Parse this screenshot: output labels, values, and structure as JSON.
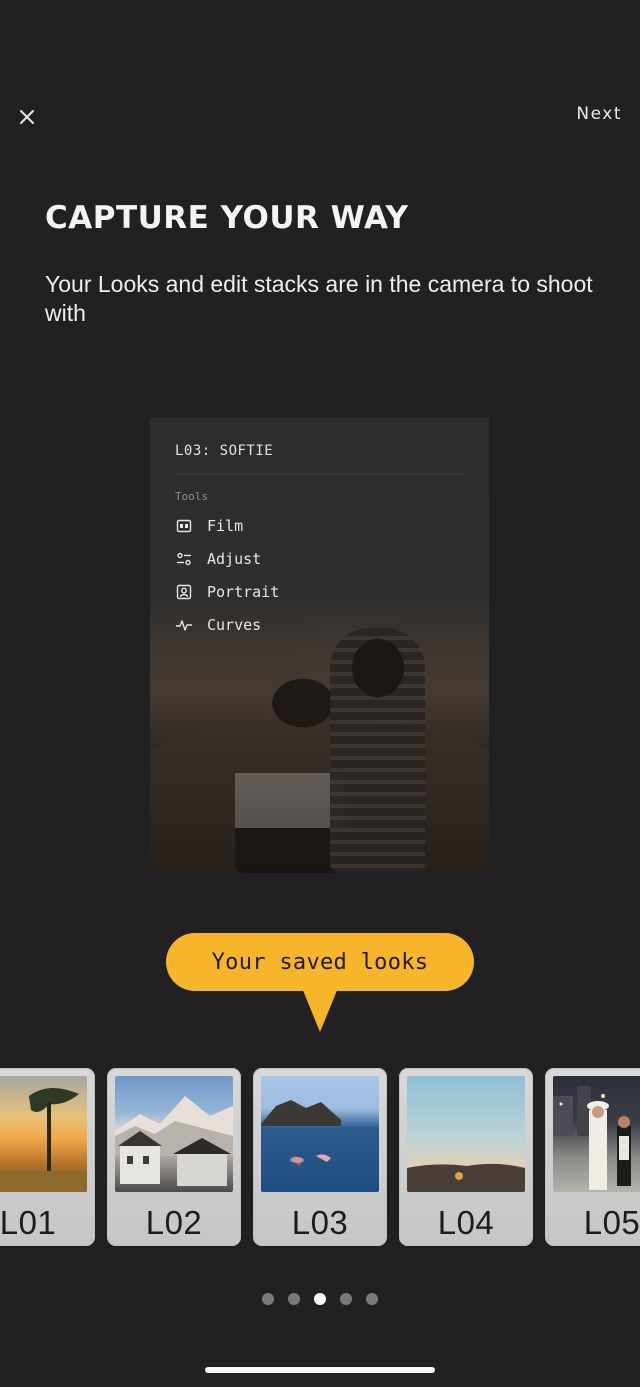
{
  "header": {
    "next_label": "Next"
  },
  "title": "CAPTURE YOUR WAY",
  "subtitle": "Your Looks and edit stacks are in the camera to shoot with",
  "preview": {
    "look_name": "L03: SOFTIE",
    "section_label": "Tools",
    "tools": [
      {
        "label": "Film",
        "icon": "film-icon"
      },
      {
        "label": "Adjust",
        "icon": "sliders-icon"
      },
      {
        "label": "Portrait",
        "icon": "portrait-icon"
      },
      {
        "label": "Curves",
        "icon": "curves-icon"
      }
    ]
  },
  "callout": "Your saved looks",
  "looks": [
    {
      "label": "L01",
      "scene": "sunset-trees"
    },
    {
      "label": "L02",
      "scene": "mountain-village"
    },
    {
      "label": "L03",
      "scene": "ocean-swimmers"
    },
    {
      "label": "L04",
      "scene": "dusk-sky"
    },
    {
      "label": "L05",
      "scene": "night-party"
    }
  ],
  "pager": {
    "count": 5,
    "active_index": 2
  },
  "colors": {
    "background": "#212123",
    "accent": "#f7b52c",
    "card": "#d0d0d0"
  }
}
